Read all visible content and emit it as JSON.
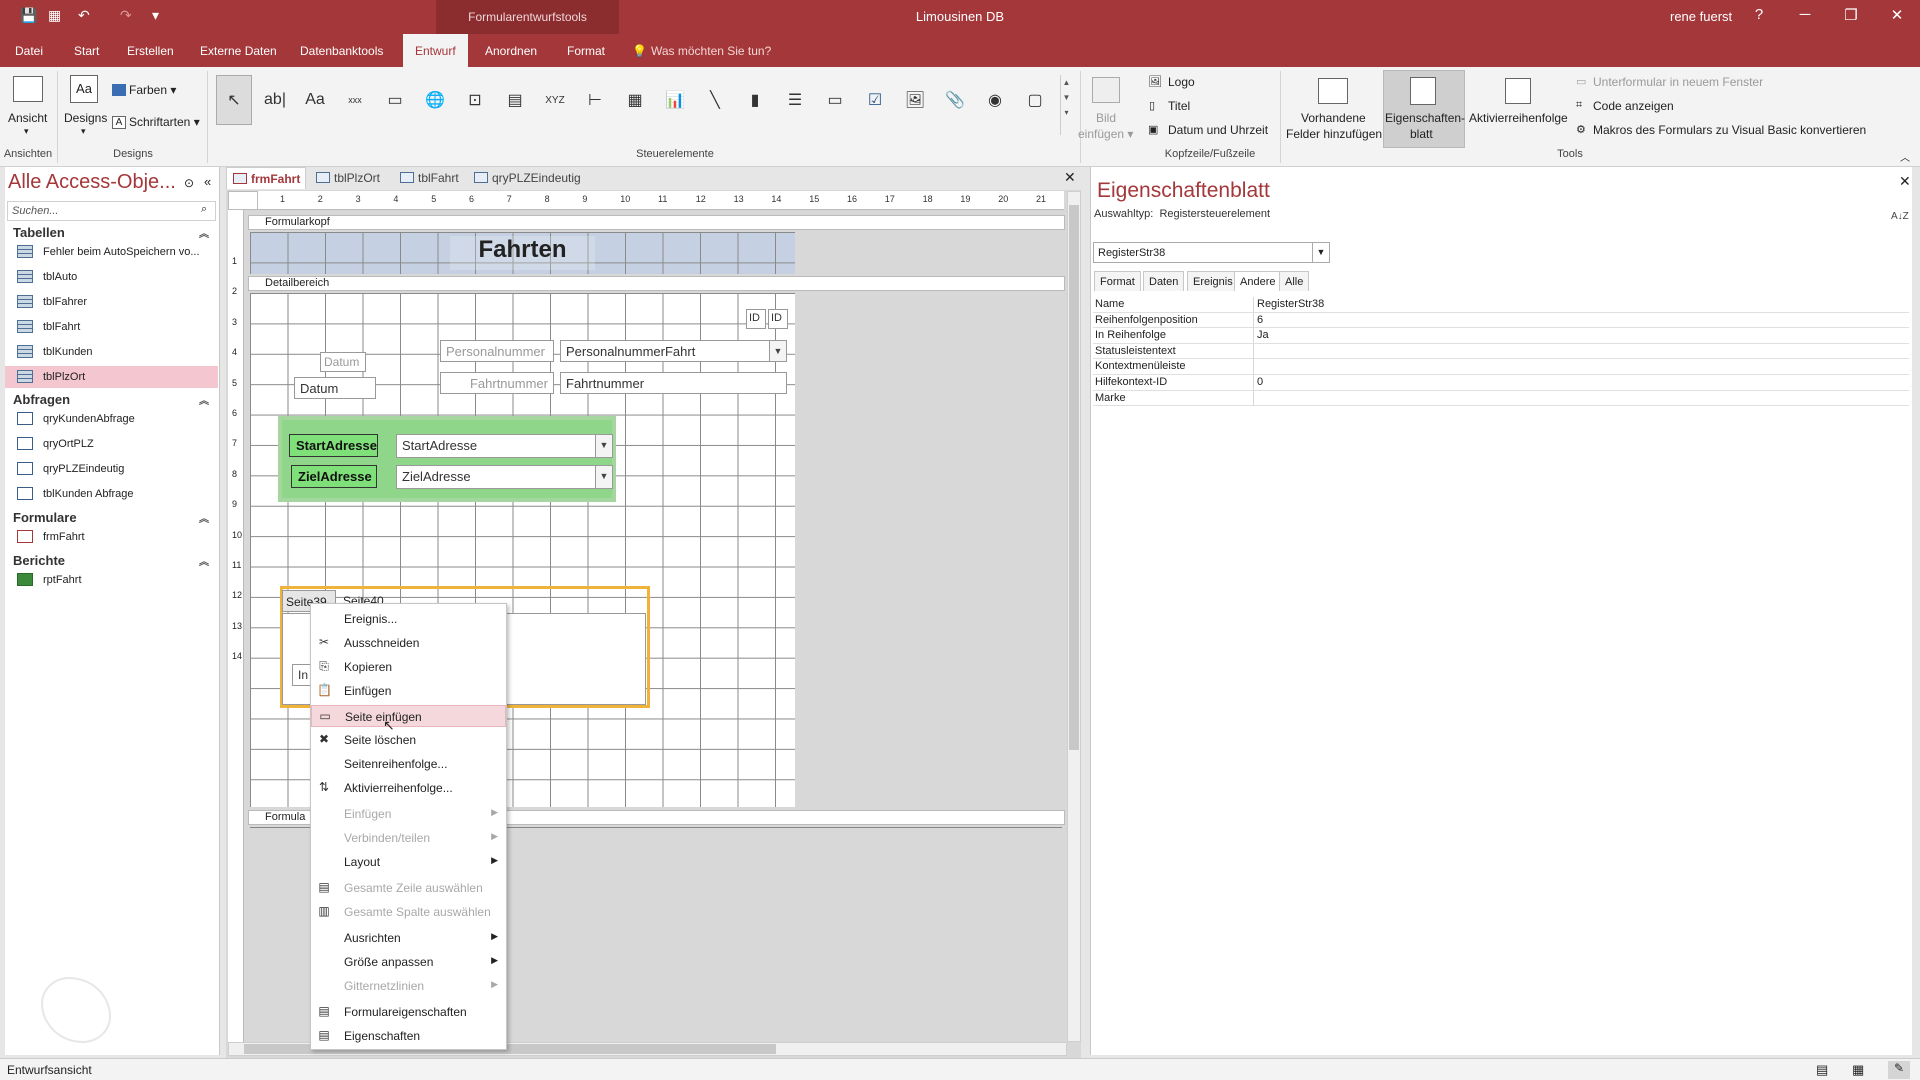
{
  "window": {
    "context_tools": "Formularentwurfstools",
    "app_title": "Limousinen DB",
    "user": "rene fuerst",
    "help": "?",
    "minimize": "─",
    "restore": "❐",
    "close": "✕"
  },
  "qat": {
    "save": "💾",
    "undo": "↶",
    "redo": "↷",
    "customize": "▾"
  },
  "menu": {
    "items": [
      "Datei",
      "Start",
      "Erstellen",
      "Externe Daten",
      "Datenbanktools",
      "Entwurf",
      "Anordnen",
      "Format"
    ],
    "tell_me": "Was möchten Sie tun?"
  },
  "ribbon": {
    "ansicht": "Ansicht",
    "designs": "Designs",
    "farben": "Farben",
    "schriftarten": "Schriftarten",
    "bild_einfuegen_1": "Bild",
    "bild_einfuegen_2": "einfügen",
    "logo": "Logo",
    "titel": "Titel",
    "datum_uhrzeit": "Datum und Uhrzeit",
    "vorhandene_1": "Vorhandene",
    "vorhandene_2": "Felder hinzufügen",
    "eigenschaften_1": "Eigenschaften-",
    "eigenschaften_2": "blatt",
    "aktivierreihenfolge": "Aktivierreihenfolge",
    "unterformular": "Unterformular in neuem Fenster",
    "code_anzeigen": "Code anzeigen",
    "makros": "Makros des Formulars zu Visual Basic konvertieren",
    "groups": {
      "ansichten": "Ansichten",
      "designs": "Designs",
      "steuerelemente": "Steuerelemente",
      "kopfzeile": "Kopfzeile/Fußzeile",
      "tools": "Tools"
    },
    "controls": [
      "↖",
      "ab|",
      "Aa",
      "xxx",
      "▭",
      "🌐",
      "⊡",
      "▤",
      "XYZ",
      "⊢",
      "▦",
      "📊",
      "╲",
      "▮",
      "☰",
      "▭",
      "☑",
      "🖼",
      "📎",
      "◉",
      "▢"
    ]
  },
  "nav": {
    "title": "Alle Access-Obje...",
    "search_placeholder": "Suchen...",
    "sections": [
      {
        "name": "Tabellen",
        "items": [
          "Fehler beim AutoSpeichern vo...",
          "tblAuto",
          "tblFahrer",
          "tblFahrt",
          "tblKunden",
          "tblPlzOrt"
        ]
      },
      {
        "name": "Abfragen",
        "items": [
          "qryKundenAbfrage",
          "qryOrtPLZ",
          "qryPLZEindeutig",
          "tblKunden Abfrage"
        ]
      },
      {
        "name": "Formulare",
        "items": [
          "frmFahrt"
        ]
      },
      {
        "name": "Berichte",
        "items": [
          "rptFahrt"
        ]
      }
    ]
  },
  "doctabs": [
    "frmFahrt",
    "tblPlzOrt",
    "tblFahrt",
    "qryPLZEindeutig"
  ],
  "form": {
    "formularkopf": "Formularkopf",
    "title": "Fahrten",
    "detailbereich": "Detailbereich",
    "formularfuss": "Formula",
    "id_label": "ID",
    "id_field": "ID",
    "datum_label": "Datum",
    "datum_field": "Datum",
    "personal_label": "Personalnummer",
    "personal_field": "PersonalnummerFahrt",
    "fahrt_label": "Fahrtnummer",
    "fahrt_field": "Fahrtnummer",
    "start_label": "StartAdresse",
    "start_field": "StartAdresse",
    "ziel_label": "ZielAdresse",
    "ziel_field": "ZielAdresse",
    "tab_page1": "Seite39",
    "tab_page2": "Seite40",
    "tab_inner": "In",
    "ruler_numbers": [
      "1",
      "2",
      "3",
      "4",
      "5",
      "6",
      "7",
      "8",
      "9",
      "10",
      "11",
      "12",
      "13",
      "14",
      "15",
      "16",
      "17",
      "18",
      "19",
      "20",
      "21"
    ]
  },
  "context_menu": [
    {
      "label": "Ereignis...",
      "disabled": false,
      "icon": ""
    },
    {
      "label": "Ausschneiden",
      "disabled": false,
      "icon": "✂"
    },
    {
      "label": "Kopieren",
      "disabled": false,
      "icon": "⎘"
    },
    {
      "label": "Einfügen",
      "disabled": false,
      "icon": "📋"
    },
    {
      "label": "Seite einfügen",
      "disabled": false,
      "icon": "▭",
      "highlight": true
    },
    {
      "label": "Seite löschen",
      "disabled": false,
      "icon": "✖"
    },
    {
      "label": "Seitenreihenfolge...",
      "disabled": false,
      "icon": ""
    },
    {
      "label": "Aktivierreihenfolge...",
      "disabled": false,
      "icon": "⇅"
    },
    {
      "label": "Einfügen",
      "disabled": true,
      "icon": "",
      "submenu": true
    },
    {
      "label": "Verbinden/teilen",
      "disabled": true,
      "icon": "",
      "submenu": true
    },
    {
      "label": "Layout",
      "disabled": false,
      "icon": "",
      "submenu": true
    },
    {
      "label": "Gesamte Zeile auswählen",
      "disabled": true,
      "icon": "▤"
    },
    {
      "label": "Gesamte Spalte auswählen",
      "disabled": true,
      "icon": "▥"
    },
    {
      "label": "Ausrichten",
      "disabled": false,
      "icon": "",
      "submenu": true
    },
    {
      "label": "Größe anpassen",
      "disabled": false,
      "icon": "",
      "submenu": true
    },
    {
      "label": "Gitternetzlinien",
      "disabled": true,
      "icon": "",
      "submenu": true
    },
    {
      "label": "Formulareigenschaften",
      "disabled": false,
      "icon": "▤"
    },
    {
      "label": "Eigenschaften",
      "disabled": false,
      "icon": "▤"
    }
  ],
  "props": {
    "title": "Eigenschaftenblatt",
    "auswahltyp_label": "Auswahltyp:",
    "auswahltyp": "Registersteuerelement",
    "selected": "RegisterStr38",
    "tabs": [
      "Format",
      "Daten",
      "Ereignis",
      "Andere",
      "Alle"
    ],
    "active_tab": "Andere",
    "rows": [
      {
        "k": "Name",
        "v": "RegisterStr38"
      },
      {
        "k": "Reihenfolgenposition",
        "v": "6"
      },
      {
        "k": "In Reihenfolge",
        "v": "Ja"
      },
      {
        "k": "Statusleistentext",
        "v": ""
      },
      {
        "k": "Kontextmenüleiste",
        "v": ""
      },
      {
        "k": "Hilfekontext-ID",
        "v": "0"
      },
      {
        "k": "Marke",
        "v": ""
      }
    ],
    "sort_icon": "A↓Z"
  },
  "status": {
    "text": "Entwurfsansicht"
  }
}
